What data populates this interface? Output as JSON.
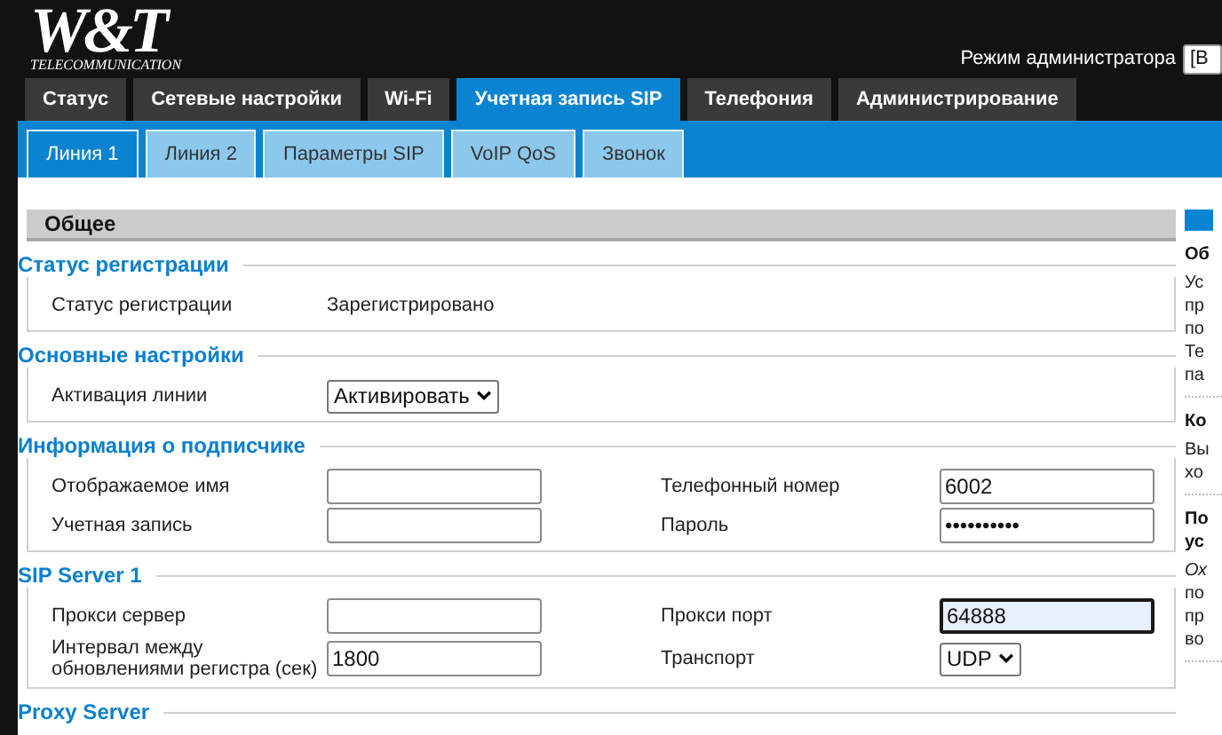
{
  "logo": {
    "mark": "W&T",
    "tagline": "TELECOMMUNICATION"
  },
  "admin": {
    "label": "Режим администратора",
    "select_value": "[В"
  },
  "tabs": [
    {
      "label": "Статус",
      "selected": false
    },
    {
      "label": "Сетевые настройки",
      "selected": false
    },
    {
      "label": "Wi-Fi",
      "selected": false
    },
    {
      "label": "Учетная запись SIP",
      "selected": true
    },
    {
      "label": "Телефония",
      "selected": false
    },
    {
      "label": "Администрирование",
      "selected": false
    }
  ],
  "subtabs": [
    {
      "label": "Линия 1",
      "selected": true
    },
    {
      "label": "Линия 2",
      "selected": false
    },
    {
      "label": "Параметры SIP",
      "selected": false
    },
    {
      "label": "VoIP QoS",
      "selected": false
    },
    {
      "label": "Звонок",
      "selected": false
    }
  ],
  "panel_title": "Общее",
  "sections": [
    {
      "title": "Статус регистрации",
      "rows": [
        [
          {
            "label": "Статус регистрации",
            "kind": "text",
            "value": "Зарегистрировано"
          }
        ]
      ]
    },
    {
      "title": "Основные настройки",
      "rows": [
        [
          {
            "label": "Активация линии",
            "kind": "select",
            "value": "Активировать"
          }
        ]
      ]
    },
    {
      "title": "Информация о подписчике",
      "rows": [
        [
          {
            "label": "Отображаемое имя",
            "kind": "input",
            "focused": false
          },
          {
            "label": "Телефонный номер",
            "kind": "input",
            "value": "6002",
            "focused": false
          }
        ],
        [
          {
            "label": "Учетная запись",
            "kind": "input",
            "focused": false
          },
          {
            "label": "Пароль",
            "kind": "password",
            "value": "••••••••••",
            "focused": false
          }
        ]
      ]
    },
    {
      "title": "SIP Server 1",
      "rows": [
        [
          {
            "label": "Прокси сервер",
            "kind": "input",
            "focused": false
          },
          {
            "label": "Прокси порт",
            "kind": "input",
            "value": "64888",
            "focused": true
          }
        ],
        [
          {
            "label": "Интервал между обновлениями регистра (сек)",
            "kind": "input",
            "value": "1800",
            "focused": false
          },
          {
            "label": "Транспорт",
            "kind": "select",
            "value": "UDP"
          }
        ]
      ]
    },
    {
      "title": "Proxy Server"
    }
  ],
  "help": [
    {
      "title": [
        "Об"
      ],
      "lines": [
        {
          "text": "Ус",
          "italic": false
        },
        {
          "text": "пр",
          "italic": false
        },
        {
          "text": "по",
          "italic": false
        },
        {
          "text": "Те",
          "italic": false
        },
        {
          "text": "па",
          "italic": false
        }
      ]
    },
    {
      "title": [
        "Ко"
      ],
      "lines": [
        {
          "text": "Вы",
          "italic": false
        },
        {
          "text": "хо",
          "italic": false
        }
      ]
    },
    {
      "title": [
        "По",
        "ус"
      ],
      "lines": [
        {
          "text": "Ох",
          "italic": true
        },
        {
          "text": "по",
          "italic": false
        },
        {
          "text": "пр",
          "italic": false
        },
        {
          "text": "во",
          "italic": false
        }
      ]
    }
  ]
}
